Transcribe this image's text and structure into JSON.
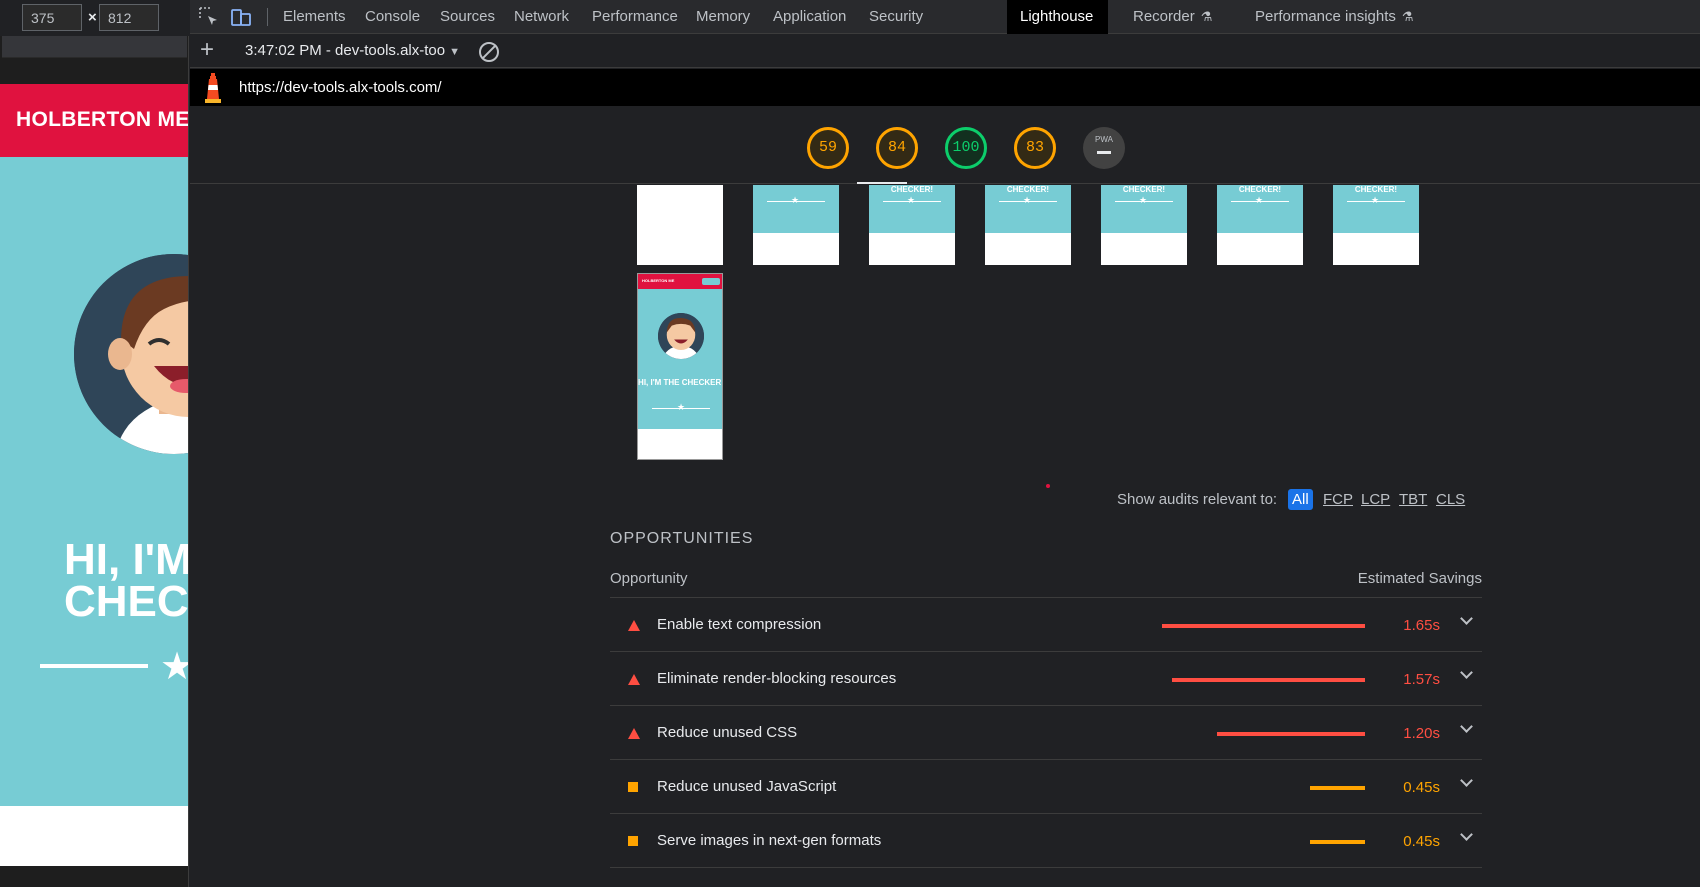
{
  "device_toolbar": {
    "width": "375",
    "height": "812",
    "separator": "×"
  },
  "viewport": {
    "header_text": "HOLBERTON ME",
    "title_line1": "HI, I'M",
    "title_line2": "CHEC"
  },
  "devtools_tabs": [
    {
      "label": "Elements"
    },
    {
      "label": "Console"
    },
    {
      "label": "Sources"
    },
    {
      "label": "Network"
    },
    {
      "label": "Performance"
    },
    {
      "label": "Memory"
    },
    {
      "label": "Application"
    },
    {
      "label": "Security"
    },
    {
      "label": "Lighthouse"
    },
    {
      "label": "Recorder"
    },
    {
      "label": "Performance insights"
    }
  ],
  "active_tab": "Lighthouse",
  "lighthouse_toolbar": {
    "report_label": "3:47:02 PM - dev-tools.alx-too"
  },
  "url": "https://dev-tools.alx-tools.com/",
  "scores": [
    {
      "value": "59",
      "status": "orange"
    },
    {
      "value": "84",
      "status": "orange"
    },
    {
      "value": "100",
      "status": "green"
    },
    {
      "value": "83",
      "status": "orange"
    },
    {
      "value": "PWA",
      "status": "pwa"
    }
  ],
  "filmstrip": {
    "frame_text": "CHECKER!",
    "final_header": "HOLBERTON ME",
    "final_title": "HI, I'M THE CHECKER!"
  },
  "filter": {
    "label": "Show audits relevant to:",
    "options": [
      "All",
      "FCP",
      "LCP",
      "TBT",
      "CLS"
    ],
    "active": "All"
  },
  "opportunities": {
    "section_title": "OPPORTUNITIES",
    "col_opportunity": "Opportunity",
    "col_savings": "Estimated Savings",
    "items": [
      {
        "title": "Enable text compression",
        "savings": "1.65s",
        "severity": "fail",
        "bar_fraction": 1.0
      },
      {
        "title": "Eliminate render-blocking resources",
        "savings": "1.57s",
        "severity": "fail",
        "bar_fraction": 0.95
      },
      {
        "title": "Reduce unused CSS",
        "savings": "1.20s",
        "severity": "fail",
        "bar_fraction": 0.73
      },
      {
        "title": "Reduce unused JavaScript",
        "savings": "0.45s",
        "severity": "average",
        "bar_fraction": 0.27
      },
      {
        "title": "Serve images in next-gen formats",
        "savings": "0.45s",
        "severity": "average",
        "bar_fraction": 0.27
      }
    ]
  },
  "colors": {
    "fail": "#ff4e42",
    "average": "#ffa400",
    "pass": "#0cce6b",
    "accent": "#1a73e8",
    "brand_red": "#e0123f",
    "brand_teal": "#77ccd4"
  }
}
